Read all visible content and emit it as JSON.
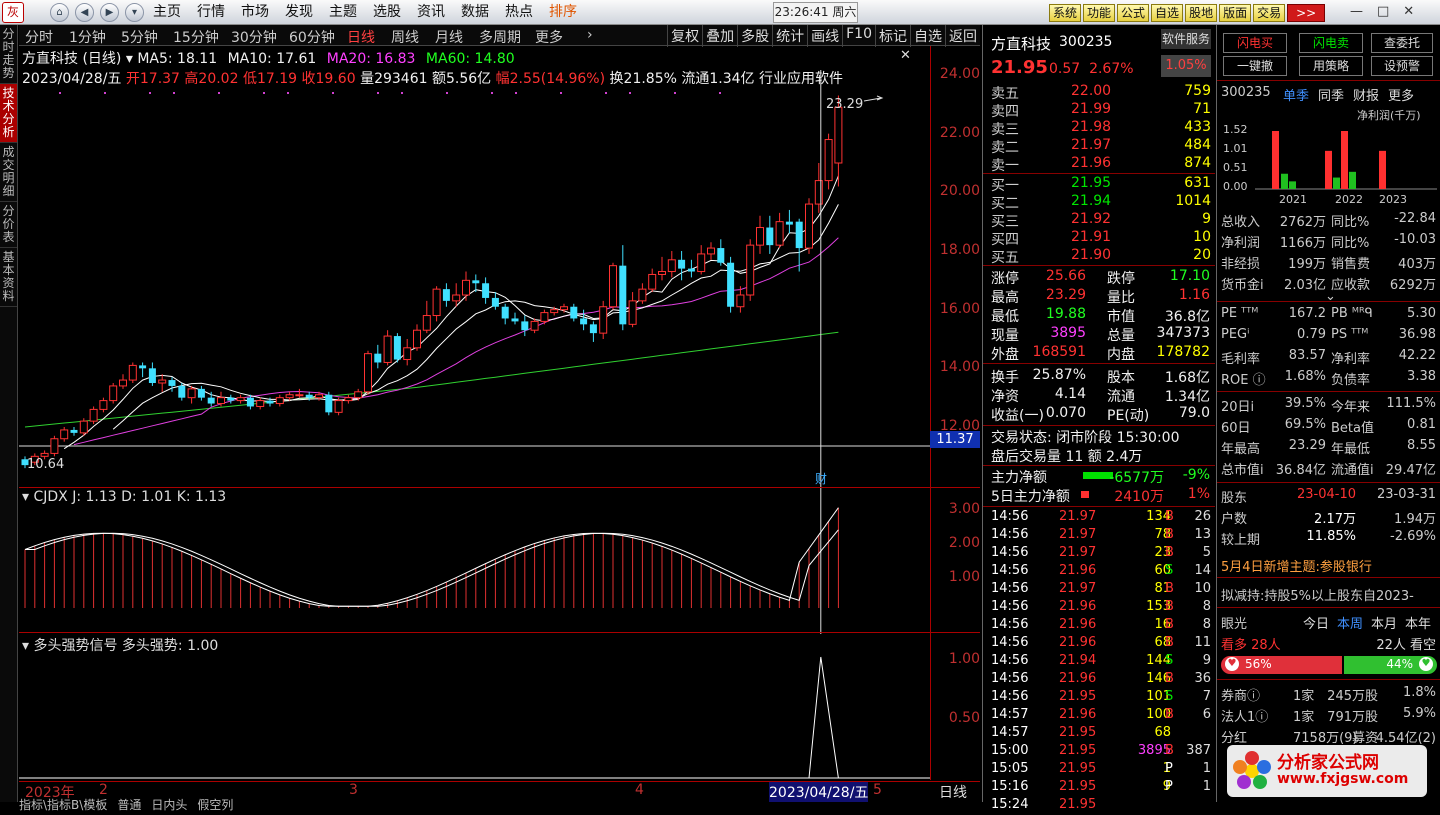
{
  "topbar": {
    "logo": "灰",
    "menu": [
      "主页",
      "行情",
      "市场",
      "发现",
      "主题",
      "选股",
      "资讯",
      "数据",
      "热点",
      "排序"
    ],
    "clock": "23:26:41 周六",
    "buttons": [
      "系统",
      "功能",
      "公式",
      "自选",
      "股地",
      "版面",
      "交易"
    ],
    "more": ">>",
    "winctl": [
      "—",
      "□",
      "✕"
    ]
  },
  "leftbar": [
    "分时走势",
    "技术分析",
    "成交明细",
    "分价表",
    "基本资料"
  ],
  "periods": [
    "分时",
    "1分钟",
    "5分钟",
    "15分钟",
    "30分钟",
    "60分钟",
    "日线",
    "周线",
    "月线",
    "多周期",
    "更多"
  ],
  "toolbar_right": [
    "复权",
    "叠加",
    "多股",
    "统计",
    "画线",
    "F10",
    "标记",
    "自选",
    "返回"
  ],
  "chart_header": {
    "name": "方直科技 (日线)",
    "ma5": "MA5: 18.11",
    "ma10": "MA10: 17.61",
    "ma20": "MA20: 16.83",
    "ma60": "MA60: 14.80"
  },
  "ohlc_line": {
    "date": "2023/04/28/五",
    "open_lbl": "开",
    "open": "17.37",
    "high_lbl": "高",
    "high": "20.02",
    "low_lbl": "低",
    "low": "17.19",
    "close_lbl": "收",
    "close": "19.60",
    "vol_lbl": "量",
    "vol": "293461",
    "amt": "额5.56亿",
    "range": "幅2.55(14.96%)",
    "turn": "换21.85%",
    "float": "流通1.34亿",
    "industry": "行业应用软件"
  },
  "main_axis": [
    "24.00",
    "22.00",
    "20.00",
    "18.00",
    "16.00",
    "14.00",
    "12.00"
  ],
  "markers": {
    "high": "23.29",
    "low": "10.64",
    "last": "11.37",
    "cai": "财"
  },
  "sub1": {
    "label": "CJDX J: 1.13 D: 1.01 K: 1.13",
    "axis": [
      "3.00",
      "2.00",
      "1.00"
    ]
  },
  "sub2": {
    "label": "多头强势信号 多头强势: 1.00",
    "axis": [
      "1.00",
      "0.50"
    ]
  },
  "time_axis": [
    "2023年",
    "2",
    "3",
    "4",
    "2023/04/28/五",
    "5",
    "日线"
  ],
  "bottom_tabs": [
    "指标\\指标B\\模板",
    "普通",
    "日内头",
    "假空列"
  ],
  "quote": {
    "name": "方直科技",
    "code": "300235",
    "service": "软件服务",
    "price": "21.95",
    "change": "0.57",
    "pct": "2.67%",
    "pct_box": "1.05%"
  },
  "orderbook": {
    "asks": [
      {
        "l": "卖五",
        "p": "22.00",
        "v": "759"
      },
      {
        "l": "卖四",
        "p": "21.99",
        "v": "71"
      },
      {
        "l": "卖三",
        "p": "21.98",
        "v": "433"
      },
      {
        "l": "卖二",
        "p": "21.97",
        "v": "484"
      },
      {
        "l": "卖一",
        "p": "21.96",
        "v": "874"
      }
    ],
    "bids": [
      {
        "l": "买一",
        "p": "21.95",
        "v": "631"
      },
      {
        "l": "买二",
        "p": "21.94",
        "v": "1014"
      },
      {
        "l": "买三",
        "p": "21.92",
        "v": "9"
      },
      {
        "l": "买四",
        "p": "21.91",
        "v": "10"
      },
      {
        "l": "买五",
        "p": "21.90",
        "v": "20"
      }
    ]
  },
  "stats": [
    {
      "a": "涨停",
      "av": "25.66",
      "ac": "red",
      "b": "跌停",
      "bv": "17.10",
      "bc": "lgrn"
    },
    {
      "a": "最高",
      "av": "23.29",
      "ac": "red",
      "b": "量比",
      "bv": "1.16",
      "bc": "red"
    },
    {
      "a": "最低",
      "av": "19.88",
      "ac": "lgrn",
      "b": "市值",
      "bv": "36.8亿",
      "bc": "wht"
    },
    {
      "a": "现量",
      "av": "3895",
      "ac": "mag",
      "b": "总量",
      "bv": "347373",
      "bc": "wht"
    },
    {
      "a": "外盘",
      "av": "168591",
      "ac": "red",
      "b": "内盘",
      "bv": "178782",
      "bc": "yel"
    },
    {
      "a": "换手",
      "av": "25.87%",
      "ac": "wht",
      "b": "股本",
      "bv": "1.68亿",
      "bc": "wht"
    },
    {
      "a": "净资",
      "av": "4.14",
      "ac": "wht",
      "b": "流通",
      "bv": "1.34亿",
      "bc": "wht"
    },
    {
      "a": "收益(一)",
      "av": "0.070",
      "ac": "wht",
      "b": "PE(动)",
      "bv": "79.0",
      "bc": "wht"
    }
  ],
  "trade_status": {
    "line1": "交易状态: 闭市阶段 15:30:00",
    "line2": "盘后交易量 11 额 2.4万"
  },
  "flows": [
    {
      "l": "主力净额",
      "v": "-6577万",
      "p": "-9%",
      "c": "lgrn"
    },
    {
      "l": "5日主力净额",
      "v": "2410万",
      "p": "1%",
      "c": "red"
    }
  ],
  "ticks": [
    [
      "14:56",
      "21.97",
      "134",
      "B",
      "26"
    ],
    [
      "14:56",
      "21.97",
      "78",
      "B",
      "13"
    ],
    [
      "14:56",
      "21.97",
      "23",
      "B",
      "5"
    ],
    [
      "14:56",
      "21.96",
      "60",
      "S",
      "14"
    ],
    [
      "14:56",
      "21.97",
      "81",
      "B",
      "10"
    ],
    [
      "14:56",
      "21.96",
      "153",
      "B",
      "8"
    ],
    [
      "14:56",
      "21.96",
      "16",
      "B",
      "8"
    ],
    [
      "14:56",
      "21.96",
      "68",
      "B",
      "11"
    ],
    [
      "14:56",
      "21.94",
      "144",
      "S",
      "9"
    ],
    [
      "14:56",
      "21.96",
      "146",
      "B",
      "36"
    ],
    [
      "14:56",
      "21.95",
      "101",
      "S",
      "7"
    ],
    [
      "14:57",
      "21.96",
      "100",
      "B",
      "6"
    ],
    [
      "14:57",
      "21.95",
      "68",
      "",
      ""
    ],
    [
      "15:00",
      "21.95",
      "3895",
      "B",
      "387"
    ],
    [
      "15:05",
      "21.95",
      "1",
      "P",
      "1"
    ],
    [
      "15:16",
      "21.95",
      "9",
      "P",
      "1"
    ],
    [
      "15:24",
      "21.95",
      "",
      "",
      " "
    ]
  ],
  "far": {
    "top_btns": [
      "闪电买",
      "闪电卖",
      "查委托",
      "一键撤",
      "用策略",
      "设预警"
    ],
    "code": "300235",
    "tabs": [
      "单季",
      "同季",
      "财报",
      "更多"
    ],
    "bar_title": "净利润(千万)",
    "bar_axis": [
      "1.52",
      "1.52",
      "1.01",
      "0.51",
      "0.00"
    ],
    "years": [
      "2021",
      "2022",
      "2023"
    ],
    "fin": [
      [
        "总收入",
        "2762万",
        "同比%",
        "-22.84"
      ],
      [
        "净利润",
        "1166万",
        "同比%",
        "-10.03"
      ],
      [
        "非经损",
        "199万",
        "销售费",
        "403万"
      ],
      [
        "货币金ⅰ",
        "2.03亿",
        "应收款",
        "6292万"
      ]
    ],
    "val": [
      [
        "PE ᵀᵀᴹ",
        "167.2",
        "PB ᴹᴿᑫ",
        "5.30"
      ],
      [
        "PEGⁱ",
        "0.79",
        "PS ᵀᵀᴹ",
        "36.98"
      ],
      [
        "毛利率",
        "83.57",
        "净利率",
        "42.22"
      ],
      [
        "ROE ⓘ",
        "1.68%",
        "负债率",
        "3.38"
      ]
    ],
    "perf": [
      [
        "20日ⅰ",
        "39.5%",
        "今年来",
        "111.5%"
      ],
      [
        "60日",
        "69.5%",
        "Beta值",
        "0.81"
      ],
      [
        "年最高",
        "23.29",
        "年最低",
        "8.55"
      ],
      [
        "总市值ⅰ",
        "36.84亿",
        "流通值ⅰ",
        "29.47亿"
      ]
    ],
    "holders": [
      [
        "股东",
        "23-04-10",
        "23-03-31"
      ],
      [
        "户数",
        "2.17万",
        "1.94万"
      ],
      [
        "较上期",
        "11.85%",
        "-2.69%"
      ]
    ],
    "news1": "5月4日新增主题:参股银行",
    "news2": "拟减持:持股5%以上股东自2023-",
    "eye": {
      "label": "眼光",
      "tabs": [
        "今日",
        "本周",
        "本月",
        "本年"
      ],
      "bull": "看多 28人",
      "bear": "22人 看空",
      "bull_pct": "56%",
      "bear_pct": "44%",
      "bull_frac": 0.56
    },
    "inst": [
      [
        "券商ⓘ",
        "1家",
        "245万股",
        "1.8%"
      ],
      [
        "法人1ⓘ",
        "1家",
        "791万股",
        "5.9%"
      ],
      [
        "分红",
        "7158万(9)",
        "募资",
        "4.54亿(2)"
      ]
    ],
    "watermark": "分析家公式网 www.fxjgsw.com"
  },
  "chart_data": {
    "type": "candlestick",
    "title": "方直科技 (日线)",
    "ylim": [
      10.5,
      24.4
    ],
    "candles": [
      [
        10.9,
        10.7,
        11.0,
        10.6
      ],
      [
        10.8,
        11.0,
        11.1,
        10.7
      ],
      [
        11.0,
        11.1,
        11.2,
        10.9
      ],
      [
        11.1,
        11.6,
        11.7,
        11.0
      ],
      [
        11.6,
        11.9,
        12.0,
        11.5
      ],
      [
        11.9,
        11.8,
        12.0,
        11.7
      ],
      [
        11.8,
        12.2,
        12.3,
        11.7
      ],
      [
        12.2,
        12.6,
        12.7,
        12.1
      ],
      [
        12.6,
        12.9,
        13.0,
        12.5
      ],
      [
        12.9,
        13.4,
        13.5,
        12.8
      ],
      [
        13.4,
        13.6,
        13.8,
        13.3
      ],
      [
        13.6,
        14.1,
        14.2,
        13.5
      ],
      [
        14.1,
        14.0,
        14.2,
        13.7
      ],
      [
        14.0,
        13.5,
        14.2,
        13.4
      ],
      [
        13.5,
        13.6,
        13.8,
        13.2
      ],
      [
        13.6,
        13.4,
        13.7,
        13.2
      ],
      [
        13.4,
        13.0,
        13.5,
        12.9
      ],
      [
        13.0,
        13.3,
        13.4,
        12.8
      ],
      [
        13.3,
        13.0,
        13.4,
        12.9
      ],
      [
        13.0,
        12.8,
        13.2,
        12.7
      ],
      [
        12.8,
        13.0,
        13.2,
        12.7
      ],
      [
        13.0,
        12.9,
        13.1,
        12.8
      ],
      [
        12.9,
        13.0,
        13.1,
        12.8
      ],
      [
        13.0,
        12.7,
        13.1,
        12.6
      ],
      [
        12.7,
        12.9,
        13.0,
        12.6
      ],
      [
        12.9,
        12.8,
        13.0,
        12.7
      ],
      [
        12.8,
        13.0,
        13.1,
        12.7
      ],
      [
        13.0,
        13.1,
        13.2,
        12.9
      ],
      [
        13.1,
        13.1,
        13.3,
        13.0
      ],
      [
        13.1,
        13.0,
        13.2,
        12.9
      ],
      [
        13.0,
        13.1,
        13.2,
        12.9
      ],
      [
        13.1,
        12.5,
        13.2,
        12.4
      ],
      [
        12.5,
        12.9,
        13.0,
        12.4
      ],
      [
        12.9,
        13.0,
        13.1,
        12.8
      ],
      [
        13.0,
        13.2,
        13.3,
        12.9
      ],
      [
        13.2,
        14.5,
        14.6,
        13.1
      ],
      [
        14.5,
        14.2,
        14.8,
        14.0
      ],
      [
        14.2,
        15.1,
        15.3,
        14.1
      ],
      [
        15.1,
        14.3,
        15.2,
        14.2
      ],
      [
        14.3,
        14.7,
        15.0,
        14.1
      ],
      [
        14.7,
        15.3,
        15.5,
        14.6
      ],
      [
        15.3,
        15.8,
        16.3,
        15.2
      ],
      [
        15.8,
        16.7,
        16.8,
        15.6
      ],
      [
        16.7,
        16.3,
        16.9,
        16.1
      ],
      [
        16.3,
        16.5,
        16.9,
        16.1
      ],
      [
        16.5,
        17.0,
        17.3,
        16.3
      ],
      [
        17.0,
        16.9,
        17.2,
        16.6
      ],
      [
        16.9,
        16.4,
        17.1,
        16.2
      ],
      [
        16.4,
        16.1,
        16.6,
        16.0
      ],
      [
        16.1,
        15.7,
        16.2,
        15.5
      ],
      [
        15.7,
        15.6,
        15.9,
        15.5
      ],
      [
        15.6,
        15.3,
        15.8,
        15.1
      ],
      [
        15.3,
        15.6,
        15.7,
        15.2
      ],
      [
        15.6,
        15.9,
        16.0,
        15.5
      ],
      [
        15.9,
        16.0,
        16.1,
        15.8
      ],
      [
        16.0,
        16.1,
        16.2,
        15.9
      ],
      [
        16.1,
        15.7,
        16.2,
        15.6
      ],
      [
        15.7,
        15.5,
        16.0,
        15.3
      ],
      [
        15.5,
        15.2,
        15.6,
        14.9
      ],
      [
        15.2,
        16.1,
        16.3,
        15.0
      ],
      [
        16.1,
        17.5,
        17.6,
        16.0
      ],
      [
        17.5,
        15.5,
        18.2,
        15.3
      ],
      [
        15.5,
        16.3,
        16.6,
        15.4
      ],
      [
        16.3,
        16.7,
        16.9,
        16.2
      ],
      [
        16.7,
        17.2,
        17.4,
        16.6
      ],
      [
        17.2,
        17.3,
        17.8,
        17.0
      ],
      [
        17.3,
        17.7,
        18.0,
        17.1
      ],
      [
        17.7,
        17.4,
        18.0,
        17.0
      ],
      [
        17.4,
        17.3,
        17.7,
        17.1
      ],
      [
        17.3,
        17.9,
        18.2,
        17.2
      ],
      [
        17.9,
        18.1,
        18.3,
        17.7
      ],
      [
        18.1,
        17.6,
        18.4,
        17.5
      ],
      [
        17.6,
        16.1,
        17.8,
        15.9
      ],
      [
        16.1,
        16.5,
        16.8,
        15.9
      ],
      [
        16.5,
        18.2,
        18.4,
        16.3
      ],
      [
        18.2,
        18.8,
        19.2,
        17.9
      ],
      [
        18.8,
        18.2,
        19.2,
        17.9
      ],
      [
        18.2,
        19.0,
        19.3,
        18.1
      ],
      [
        19.0,
        18.9,
        19.4,
        18.6
      ],
      [
        19.0,
        18.1,
        19.1,
        17.3
      ],
      [
        18.1,
        19.6,
        19.8,
        17.9
      ],
      [
        19.6,
        20.4,
        21.0,
        19.3
      ],
      [
        20.4,
        21.8,
        22.0,
        20.1
      ],
      [
        21.0,
        22.9,
        23.3,
        20.2
      ]
    ],
    "ma5_end": 18.11,
    "ma10_end": 17.61,
    "ma20_end": 16.83,
    "ma60_end": 14.8
  }
}
